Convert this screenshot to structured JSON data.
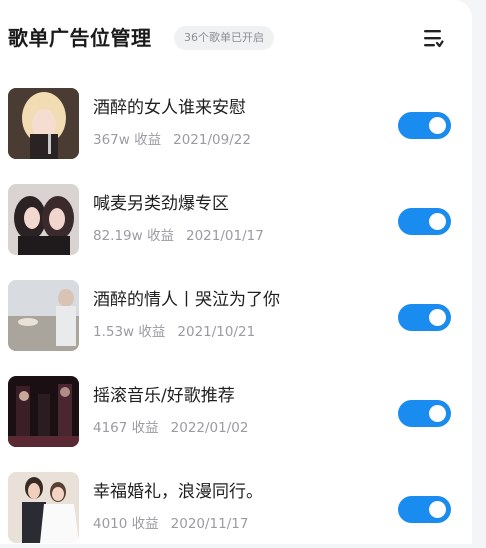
{
  "header": {
    "title": "歌单广告位管理",
    "badge": "36个歌单已开启"
  },
  "playlists": [
    {
      "name": "酒醉的女人谁来安慰",
      "earnings": "367w 收益",
      "date": "2021/09/22",
      "enabled": true
    },
    {
      "name": "喊麦另类劲爆专区",
      "earnings": "82.19w 收益",
      "date": "2021/01/17",
      "enabled": true
    },
    {
      "name": "酒醉的情人丨哭泣为了你",
      "earnings": "1.53w 收益",
      "date": "2021/10/21",
      "enabled": true
    },
    {
      "name": "摇滚音乐/好歌推荐",
      "earnings": "4167 收益",
      "date": "2022/01/02",
      "enabled": true
    },
    {
      "name": "幸福婚礼，浪漫同行。",
      "earnings": "4010 收益",
      "date": "2020/11/17",
      "enabled": true
    }
  ],
  "colors": {
    "accent": "#1a8cf0",
    "badge_bg": "#f0f1f3",
    "meta_text": "#9a9ca1"
  },
  "icons": {
    "sort": "sort-list-icon"
  }
}
